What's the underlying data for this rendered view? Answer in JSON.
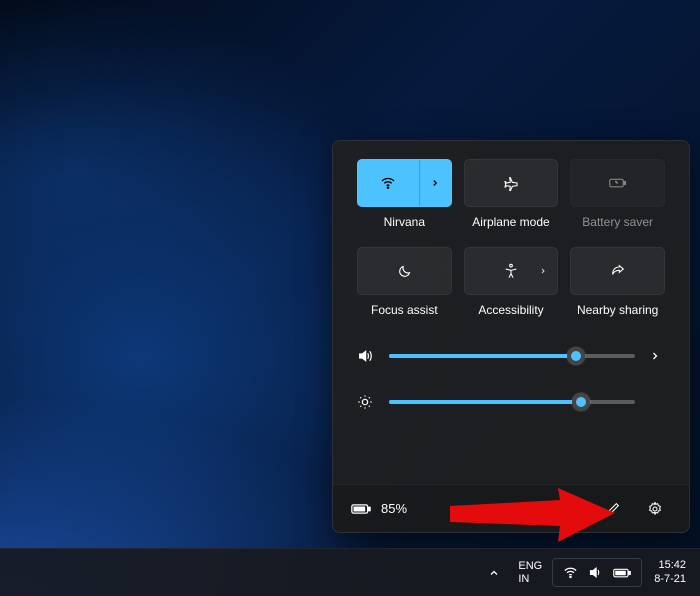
{
  "quick_settings": {
    "tiles": {
      "wifi": {
        "label": "Nirvana",
        "active": true,
        "disabled": false
      },
      "airplane": {
        "label": "Airplane mode",
        "active": false,
        "disabled": false
      },
      "battery_saver": {
        "label": "Battery saver",
        "active": false,
        "disabled": true
      },
      "focus_assist": {
        "label": "Focus assist",
        "active": false,
        "disabled": false
      },
      "accessibility": {
        "label": "Accessibility",
        "active": false,
        "disabled": false
      },
      "nearby_sharing": {
        "label": "Nearby sharing",
        "active": false,
        "disabled": false
      }
    },
    "volume_percent": 76,
    "brightness_percent": 78,
    "battery_text": "85%"
  },
  "taskbar": {
    "lang_line1": "ENG",
    "lang_line2": "IN",
    "time": "15:42",
    "date": "8-7-21"
  }
}
